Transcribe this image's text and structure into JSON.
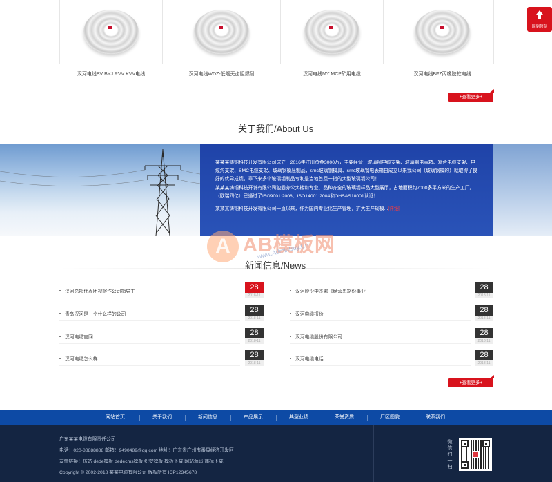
{
  "products": [
    {
      "name": "汉河电线BV BYJ RVV KVV电线"
    },
    {
      "name": "汉河电线WDZ-低烟无卤阻燃耐"
    },
    {
      "name": "汉河电线MY MCP矿用电缆"
    },
    {
      "name": "汉河电线BFZ丙橡胶软电线"
    }
  ],
  "products_more": "+查看更多+",
  "about": {
    "title": "关于我们/About Us",
    "paragraphs": [
      "某某某铸铜科技开发有限公司成立于2016年注册资金3000万，主要经营：玻璃钢电缆支架、玻璃钢电表箱、复合电缆支架、电缆沟支架、SMC电缆支架、玻璃钢模压制品，smc玻璃钢模具、smc玻璃钢电表箱自成立以来我公司（玻璃钢模的）就取得了良好的优异成绩，章下来多个玻璃钢制品专利是当地首屈一指的大型玻璃钢公司！",
      "某某某铸铜科技开发有限公司独霸办公大楼和专业、品种齐全的玻璃钢样品大型展厅，占地面积约7000多平方米的生产工厂。（欧瑞四亿）已通过了ISO9001:2008、ISO14001:2004和OHSAS18001认证！"
    ],
    "last_line": "某某某铸铜科技开发有限公司一直以来，作为国内专业化生产管理，扩大生产规模...",
    "detail_link": "[详细]"
  },
  "news": {
    "title": "新闻信息/News",
    "left": [
      {
        "title": "汉河总部代表团视察作公司指导工",
        "day": "28",
        "ym": "2018-11"
      },
      {
        "title": "青岛汉河是一个什么样的公司",
        "day": "28",
        "ym": "2018-11"
      },
      {
        "title": "汉河电缆官网",
        "day": "28",
        "ym": "2018-11"
      },
      {
        "title": "汉河电缆怎么样",
        "day": "28",
        "ym": "2018-11"
      }
    ],
    "right": [
      {
        "title": "汉河股份中签署《经营恩豁份事业",
        "day": "28",
        "ym": "2018-11"
      },
      {
        "title": "汉河电缆报价",
        "day": "28",
        "ym": "2018-11"
      },
      {
        "title": "汉河电缆股份有限公司",
        "day": "28",
        "ym": "2018-11"
      },
      {
        "title": "汉河电缆电话",
        "day": "28",
        "ym": "2018-11"
      }
    ],
    "more": "+查看更多+"
  },
  "footer_nav": [
    "网站首页",
    "关于我们",
    "新闻信息",
    "产品展示",
    "典型业绩",
    "荣誉资质",
    "厂区图貌",
    "联系我们"
  ],
  "footer": {
    "company": "广东某某电缆有限责任公司",
    "contact": "电话：020-88888888   邮箱：9490489@qq.com   地址：广东省广州市番禺经济开发区",
    "links": "友情链接：仿站  dede模板  dedecms模板  织梦模板  模板下载  网站源码  商标下载",
    "copyright": "Copyright © 2002-2018 某某电缆有限公司 版权所有    ICP12345678",
    "scan": "微信扫一扫"
  },
  "side_button": {
    "label": "回到顶部",
    "icon": "arrow-up-icon"
  },
  "watermark": {
    "brand": "AB模板网",
    "url": "www.AdminBuy.Cn",
    "logo_letter": "A"
  },
  "colors": {
    "accent": "#d8131d",
    "nav_blue": "#0d4aa5",
    "footer_dark": "#142542",
    "about_blue": "#2a53b8"
  }
}
